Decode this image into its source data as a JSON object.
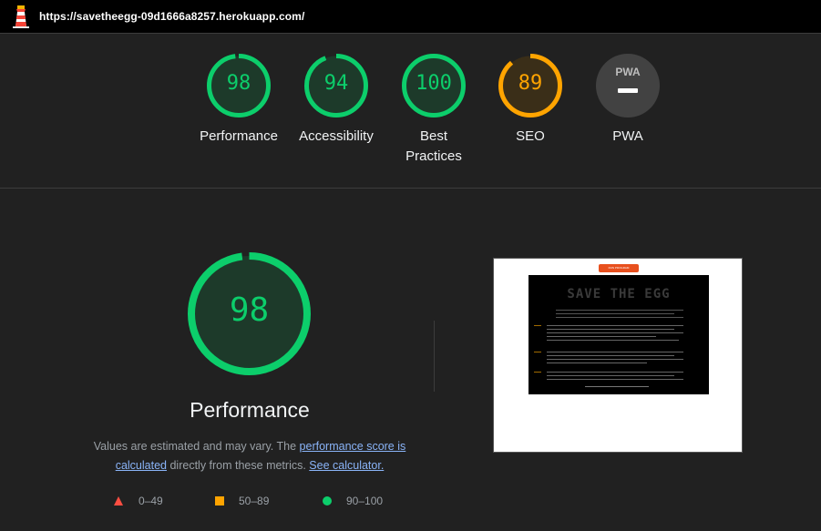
{
  "browser": {
    "url": "https://savetheegg-09d1666a8257.herokuapp.com/"
  },
  "scores": [
    {
      "label": "Performance",
      "value": "98",
      "fraction": 0.98
    },
    {
      "label": "Accessibility",
      "value": "94",
      "fraction": 0.94
    },
    {
      "label": "Best Practices",
      "value": "100",
      "fraction": 1.0
    },
    {
      "label": "SEO",
      "value": "89",
      "fraction": 0.89
    },
    {
      "label": "PWA",
      "value": ""
    }
  ],
  "main": {
    "score": "98",
    "score_fraction": 0.98,
    "title": "Performance",
    "desc_part1": "Values are estimated and may vary. The ",
    "link1": "performance score is calculated",
    "desc_part2": " directly from these metrics. ",
    "link2": "See calculator."
  },
  "legend": {
    "fail": "0–49",
    "average": "50–89",
    "pass": "90–100"
  },
  "screenshot": {
    "button_text": "RUN PROGRAM",
    "game_title": "SAVE THE EGG"
  },
  "colors": {
    "pass": "#0cce6b",
    "average": "#ffa400",
    "fail": "#ff4e42",
    "background": "#212121"
  },
  "icons": {
    "logo": "lighthouse-icon",
    "pwa": "pwa-icon"
  }
}
